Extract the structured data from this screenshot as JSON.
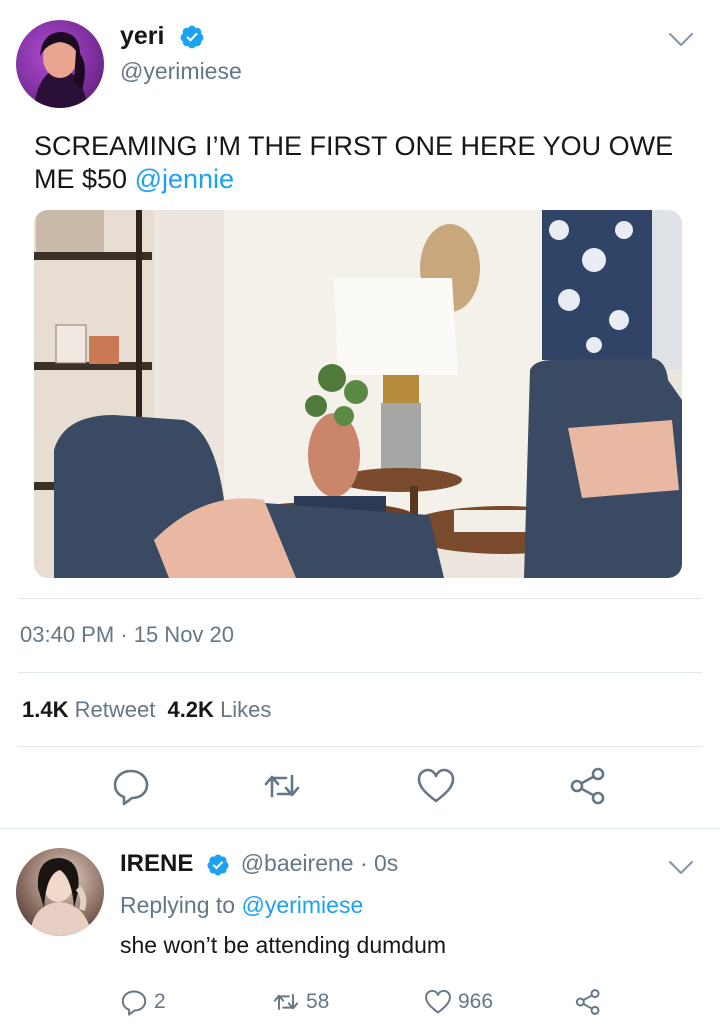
{
  "tweet": {
    "name": "yeri",
    "handle": "@yerimiese",
    "text_main": "SCREAMING I’M THE FIRST ONE HERE YOU OWE ME $50 ",
    "text_mention": "@jennie",
    "timestamp": "03:40 PM · 15 Nov 20",
    "retweet_count": "1.4K",
    "retweet_label": "Retweet",
    "like_count": "4.2K",
    "like_label": "Likes"
  },
  "reply": {
    "name": "IRENE",
    "handle_time": "@baeirene · 0s",
    "replying_prefix": "Replying to ",
    "replying_handle": "@yerimiese",
    "text": "she won’t be attending dumdum",
    "reply_count": "2",
    "retweet_count": "58",
    "like_count": "966"
  },
  "icons": {
    "verified": "verified-badge-icon",
    "chevron": "chevron-down-icon",
    "reply": "reply-icon",
    "retweet": "retweet-icon",
    "like": "heart-icon",
    "share": "share-icon"
  },
  "colors": {
    "accent": "#1da1f2",
    "muted": "#657786",
    "text": "#14171a"
  }
}
